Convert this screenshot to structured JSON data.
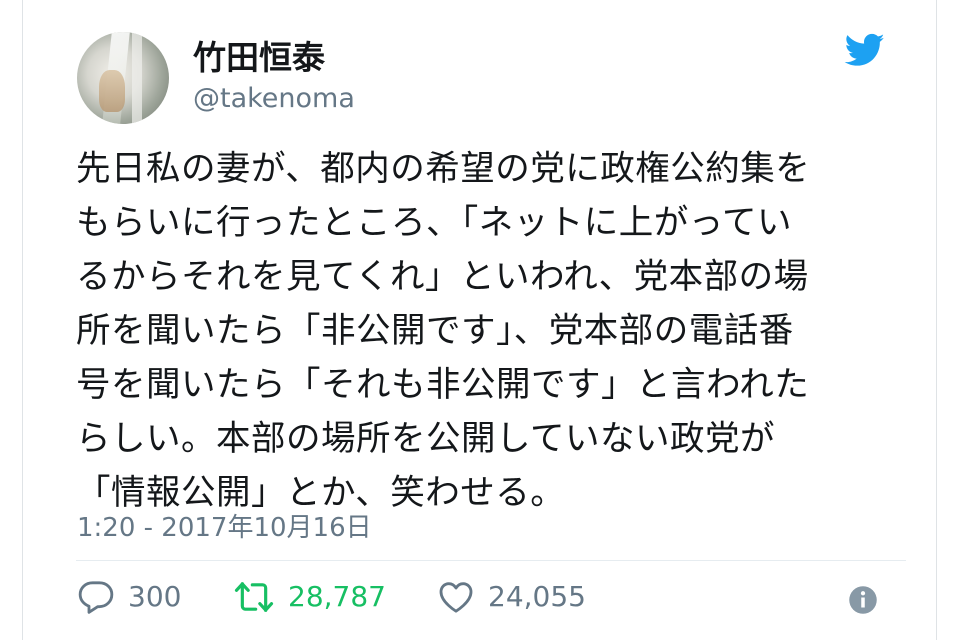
{
  "user": {
    "display_name": "竹田恒泰",
    "handle": "@takenoma"
  },
  "tweet": {
    "text": "先日私の妻が、都内の希望の党に政権公約集を\nもらいに行ったところ、「ネットに上がってい\nるからそれを見てくれ」といわれ、党本部の場\n所を聞いたら「非公開です」、党本部の電話番\n号を聞いたら「それも非公開です」と言われた\nらしい。本部の場所を公開していない政党が\n「情報公開」とか、笑わせる。",
    "timestamp": "1:20 - 2017年10月16日"
  },
  "actions": {
    "reply_count": "300",
    "retweet_count": "28,787",
    "like_count": "24,055"
  },
  "icons": {
    "brand": "twitter-bird-icon",
    "reply": "reply-bubble-icon",
    "retweet": "retweet-icon",
    "like": "heart-icon",
    "info": "info-icon"
  },
  "colors": {
    "twitter_blue": "#1da1f2",
    "retweet_green": "#17bf63",
    "secondary_text": "#657786",
    "primary_text": "#14171a"
  }
}
